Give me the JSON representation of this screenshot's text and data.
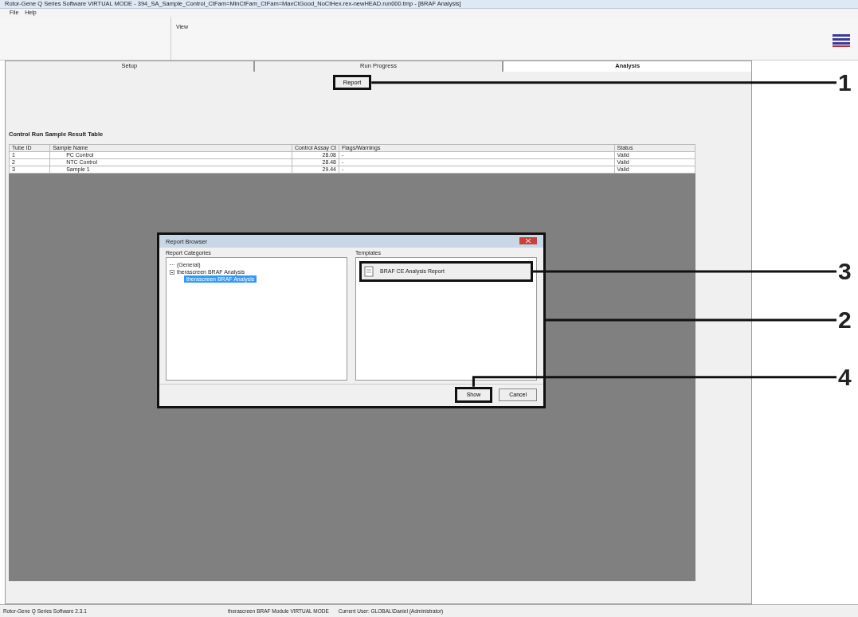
{
  "window": {
    "title": "Rotor-Gene Q Series Software VIRTUAL MODE - 394_SA_Sample_Control_CtFam=MinCtFam_CtFam=MaxCtGood_NoCtHex.rex-newHEAD.run000.tmp - [BRAF Analysis]"
  },
  "menu": [
    "File",
    "Help"
  ],
  "toolbar": {
    "label": "View"
  },
  "tabs": [
    {
      "label": "Setup",
      "selected": false
    },
    {
      "label": "Run Progress",
      "selected": false
    },
    {
      "label": "Analysis",
      "selected": true
    }
  ],
  "report_button": "Report",
  "table": {
    "title": "Control Run Sample Result Table",
    "columns": [
      "Tube ID",
      "Sample Name",
      "Control Assay Ct",
      "Flags/Warnings",
      "Status"
    ],
    "rows": [
      [
        "1",
        "PC Control",
        "28.08",
        "-",
        "Valid"
      ],
      [
        "2",
        "NTC Control",
        "28.48",
        "-",
        "Valid"
      ],
      [
        "3",
        "Sample 1",
        "29.44",
        "-",
        "Valid"
      ]
    ]
  },
  "dialog": {
    "title": "Report Browser",
    "categories_label": "Report Categories",
    "tree": [
      {
        "label": "(General)",
        "selected": false
      },
      {
        "label": "therascreen BRAF Analysis",
        "selected": false,
        "expanded": true,
        "children": [
          {
            "label": "therascreen BRAF Analysis",
            "selected": true
          }
        ]
      }
    ],
    "templates_label": "Templates",
    "templates": [
      {
        "label": "BRAF CE Analysis Report",
        "selected": false
      }
    ],
    "buttons": [
      {
        "label": "Show",
        "kind": "primary"
      },
      {
        "label": "Cancel",
        "kind": "secondary"
      }
    ]
  },
  "callouts": [
    {
      "number": "1",
      "kind": "report"
    },
    {
      "number": "3",
      "kind": "template"
    },
    {
      "number": "2",
      "kind": "dialog"
    },
    {
      "number": "4",
      "kind": "show"
    }
  ],
  "status_bar": [
    "Rotor-Gene Q Series Software 2.3.1",
    "therascreen BRAF Module  VIRTUAL MODE",
    "Current User: GLOBAL\\Daniel (Administrator)"
  ]
}
